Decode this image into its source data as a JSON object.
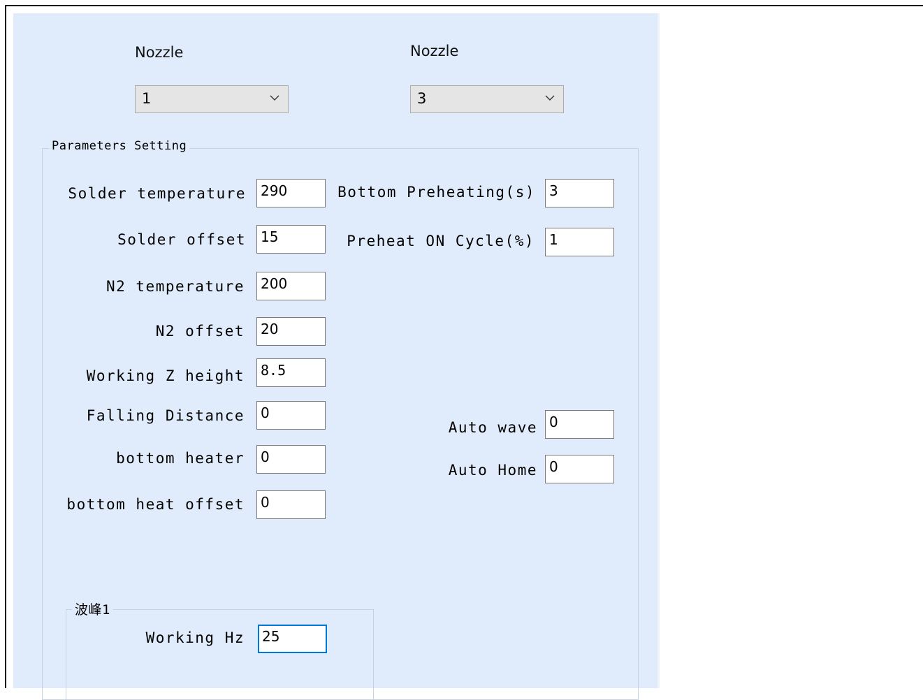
{
  "nozzle_left": {
    "label": "Nozzle",
    "selected": "1"
  },
  "nozzle_right": {
    "label": "Nozzle",
    "selected": "3"
  },
  "parameters": {
    "group_title": "Parameters Setting",
    "solder_temperature": {
      "label": "Solder temperature",
      "value": "290"
    },
    "solder_offset": {
      "label": "Solder offset",
      "value": "15"
    },
    "n2_temperature": {
      "label": "N2 temperature",
      "value": "200"
    },
    "n2_offset": {
      "label": "N2 offset",
      "value": "20"
    },
    "working_z_height": {
      "label": "Working Z height",
      "value": "8.5"
    },
    "falling_distance": {
      "label": "Falling Distance",
      "value": "0"
    },
    "bottom_heater": {
      "label": "bottom heater",
      "value": "0"
    },
    "bottom_heat_offset": {
      "label": "bottom heat offset",
      "value": "0"
    },
    "bottom_preheating": {
      "label": "Bottom Preheating(s)",
      "value": "3"
    },
    "preheat_on_cycle": {
      "label": "Preheat ON Cycle(%)",
      "value": "1"
    },
    "auto_wave": {
      "label": "Auto wave",
      "value": "0"
    },
    "auto_home": {
      "label": "Auto Home",
      "value": "0"
    }
  },
  "wave": {
    "group_title": "波峰1",
    "working_hz": {
      "label": "Working Hz",
      "value": "25"
    }
  },
  "colors": {
    "panel_bg": "#e0ecfb",
    "focus_border": "#0078d7",
    "combo_bg": "#e5e5e5"
  }
}
